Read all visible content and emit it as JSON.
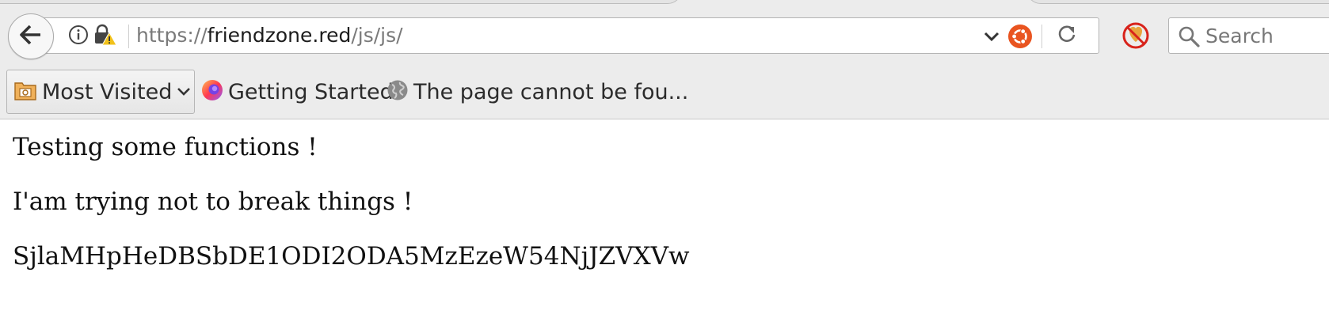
{
  "browser": {
    "url": {
      "scheme": "https://",
      "domain": "friendzone.red",
      "path": "/js/js/"
    },
    "search": {
      "placeholder": "Search"
    },
    "bookmarks": {
      "most_visited_label": "Most Visited",
      "getting_started_label": "Getting Started",
      "page_not_found_label": "The page cannot be fou..."
    },
    "icons": {
      "back": "back-arrow-icon",
      "site_info": "info-icon",
      "insecure_lock": "lock-warning-icon",
      "dropdown": "chevron-down-icon",
      "ubuntu": "ubuntu-icon",
      "reload": "reload-icon",
      "blocked": "blocked-addon-icon",
      "search": "search-icon",
      "most_visited": "folder-icon",
      "getting_started": "firefox-icon",
      "page_not_found": "globe-icon"
    },
    "colors": {
      "chrome_bg": "#ececec",
      "ubuntu_orange": "#e95420",
      "warning_yellow": "#f2c21b",
      "blocked_red": "#d8231b"
    }
  },
  "page": {
    "line1": "Testing some functions !",
    "line2": "I'am trying not to break things !",
    "line3": "SjlaMHpHeDBSbDE1ODI2ODA5MzEzeW54NjJZVXVw"
  }
}
